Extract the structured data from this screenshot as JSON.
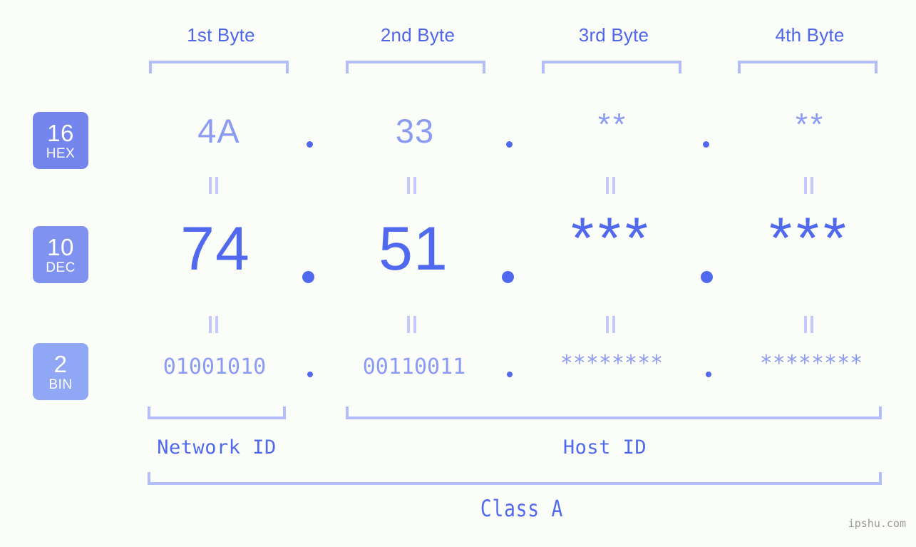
{
  "meta": {
    "background": "#fbfdf8",
    "accent_strong": "#5169ee",
    "accent_light": "#8c9bf2",
    "bracket_color": "#b3bdfa",
    "separator_color": "#c3cafb"
  },
  "byte_headers": [
    {
      "label": "1st Byte"
    },
    {
      "label": "2nd Byte"
    },
    {
      "label": "3rd Byte"
    },
    {
      "label": "4th Byte"
    }
  ],
  "radix_badges": [
    {
      "num": "16",
      "name": "HEX",
      "color": "#7585ee"
    },
    {
      "num": "10",
      "name": "DEC",
      "color": "#8092ef"
    },
    {
      "num": "2",
      "name": "BIN",
      "color": "#8fa7f4"
    }
  ],
  "rows": {
    "hex": {
      "radix": "16",
      "values": [
        "4A",
        "33",
        "**",
        "**"
      ]
    },
    "dec": {
      "radix": "10",
      "values": [
        "74",
        "51",
        "***",
        "***"
      ]
    },
    "bin": {
      "radix": "2",
      "values": [
        "01001010",
        "00110011",
        "********",
        "********"
      ]
    }
  },
  "separator_dot": ".",
  "equality_marker": "=",
  "footer": {
    "network_id_label": "Network ID",
    "host_id_label": "Host ID",
    "class_label": "Class A"
  },
  "watermark": "ipshu.com"
}
